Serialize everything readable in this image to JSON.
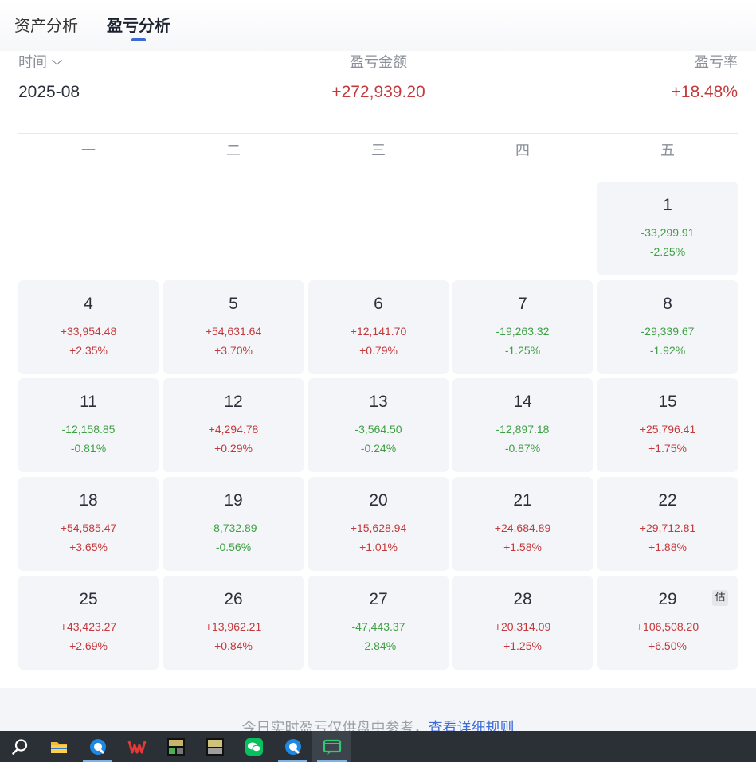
{
  "tabs": [
    {
      "label": "资产分析",
      "active": false
    },
    {
      "label": "盈亏分析",
      "active": true
    }
  ],
  "summary": {
    "time_label": "时间",
    "time_value": "2025-08",
    "amount_label": "盈亏金额",
    "amount_value": "+272,939.20",
    "rate_label": "盈亏率",
    "rate_value": "+18.48%"
  },
  "weekdays": [
    "一",
    "二",
    "三",
    "四",
    "五"
  ],
  "calendar": {
    "estimate_badge": "估",
    "days": [
      {
        "day": "1",
        "amount": "-33,299.91",
        "pct": "-2.25%",
        "sign": "neg"
      },
      {
        "day": "4",
        "amount": "+33,954.48",
        "pct": "+2.35%",
        "sign": "pos"
      },
      {
        "day": "5",
        "amount": "+54,631.64",
        "pct": "+3.70%",
        "sign": "pos"
      },
      {
        "day": "6",
        "amount": "+12,141.70",
        "pct": "+0.79%",
        "sign": "pos"
      },
      {
        "day": "7",
        "amount": "-19,263.32",
        "pct": "-1.25%",
        "sign": "neg"
      },
      {
        "day": "8",
        "amount": "-29,339.67",
        "pct": "-1.92%",
        "sign": "neg"
      },
      {
        "day": "11",
        "amount": "-12,158.85",
        "pct": "-0.81%",
        "sign": "neg"
      },
      {
        "day": "12",
        "amount": "+4,294.78",
        "pct": "+0.29%",
        "sign": "pos"
      },
      {
        "day": "13",
        "amount": "-3,564.50",
        "pct": "-0.24%",
        "sign": "neg"
      },
      {
        "day": "14",
        "amount": "-12,897.18",
        "pct": "-0.87%",
        "sign": "neg"
      },
      {
        "day": "15",
        "amount": "+25,796.41",
        "pct": "+1.75%",
        "sign": "pos"
      },
      {
        "day": "18",
        "amount": "+54,585.47",
        "pct": "+3.65%",
        "sign": "pos"
      },
      {
        "day": "19",
        "amount": "-8,732.89",
        "pct": "-0.56%",
        "sign": "neg"
      },
      {
        "day": "20",
        "amount": "+15,628.94",
        "pct": "+1.01%",
        "sign": "pos"
      },
      {
        "day": "21",
        "amount": "+24,684.89",
        "pct": "+1.58%",
        "sign": "pos"
      },
      {
        "day": "22",
        "amount": "+29,712.81",
        "pct": "+1.88%",
        "sign": "pos"
      },
      {
        "day": "25",
        "amount": "+43,423.27",
        "pct": "+2.69%",
        "sign": "pos"
      },
      {
        "day": "26",
        "amount": "+13,962.21",
        "pct": "+0.84%",
        "sign": "pos"
      },
      {
        "day": "27",
        "amount": "-47,443.37",
        "pct": "-2.84%",
        "sign": "neg"
      },
      {
        "day": "28",
        "amount": "+20,314.09",
        "pct": "+1.25%",
        "sign": "pos"
      },
      {
        "day": "29",
        "amount": "+106,508.20",
        "pct": "+6.50%",
        "sign": "pos",
        "estimated": true
      }
    ]
  },
  "footer": {
    "note": "今日实时盈亏仅供盘中参考，",
    "link": "查看详细规则"
  },
  "colors": {
    "positive": "#c4393c",
    "negative": "#3ea044",
    "accent": "#3d6bd6"
  },
  "taskbar": {
    "icons": [
      "search-icon",
      "file-explorer-icon",
      "browser-icon",
      "wps-office-icon",
      "stock-app-icon",
      "stock-app-2-icon",
      "wechat-icon",
      "browser-icon",
      "chat-app-icon"
    ]
  }
}
